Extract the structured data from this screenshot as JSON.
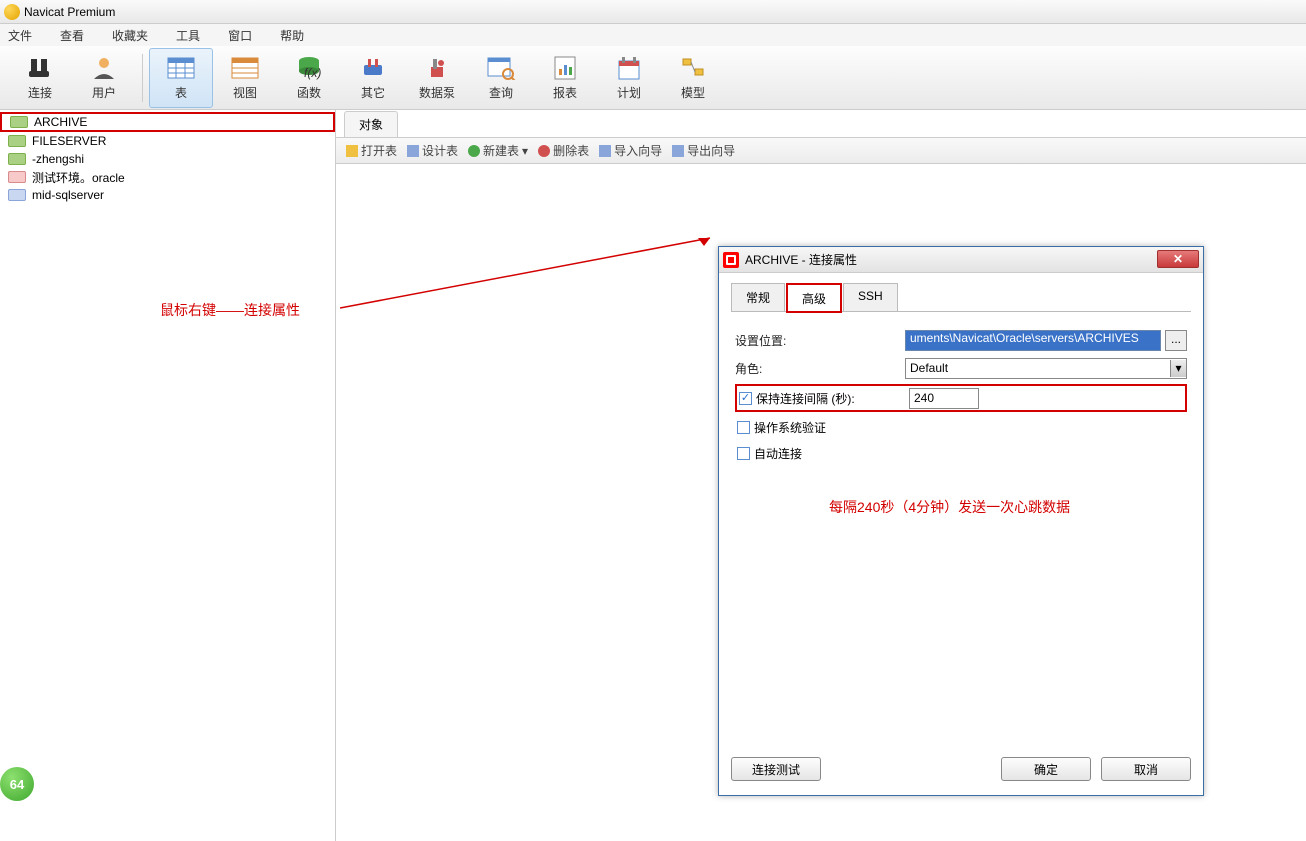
{
  "app": {
    "title": "Navicat Premium"
  },
  "menu": {
    "file": "文件",
    "view": "查看",
    "fav": "收藏夹",
    "tools": "工具",
    "window": "窗口",
    "help": "帮助"
  },
  "toolbar": {
    "connect": "连接",
    "user": "用户",
    "table": "表",
    "view": "视图",
    "func": "函数",
    "other": "其它",
    "pump": "数据泵",
    "query": "查询",
    "report": "报表",
    "plan": "计划",
    "model": "模型"
  },
  "connections": {
    "archive": "ARCHIVE",
    "fileserver": "FILESERVER",
    "zhengshi": "-zhengshi",
    "testenv": "测试环境。oracle",
    "midsql": "mid-sqlserver"
  },
  "tabs": {
    "object": "对象"
  },
  "actions": {
    "open": "打开表",
    "design": "设计表",
    "new": "新建表",
    "delete": "删除表",
    "import": "导入向导",
    "export": "导出向导"
  },
  "annotation1": "鼠标右键——连接属性",
  "dialog": {
    "title": "ARCHIVE - 连接属性",
    "tabs": {
      "general": "常规",
      "advanced": "高级",
      "ssh": "SSH"
    },
    "labels": {
      "location": "设置位置:",
      "role": "角色:",
      "keepalive": "保持连接间隔 (秒):",
      "osauth": "操作系统验证",
      "autoconnect": "自动连接"
    },
    "values": {
      "path": "uments\\Navicat\\Oracle\\servers\\ARCHIVES",
      "role": "Default",
      "interval": "240"
    },
    "buttons": {
      "test": "连接测试",
      "ok": "确定",
      "cancel": "取消"
    },
    "browse": "...",
    "annotation": "每隔240秒（4分钟）发送一次心跳数据"
  },
  "badge": "64"
}
